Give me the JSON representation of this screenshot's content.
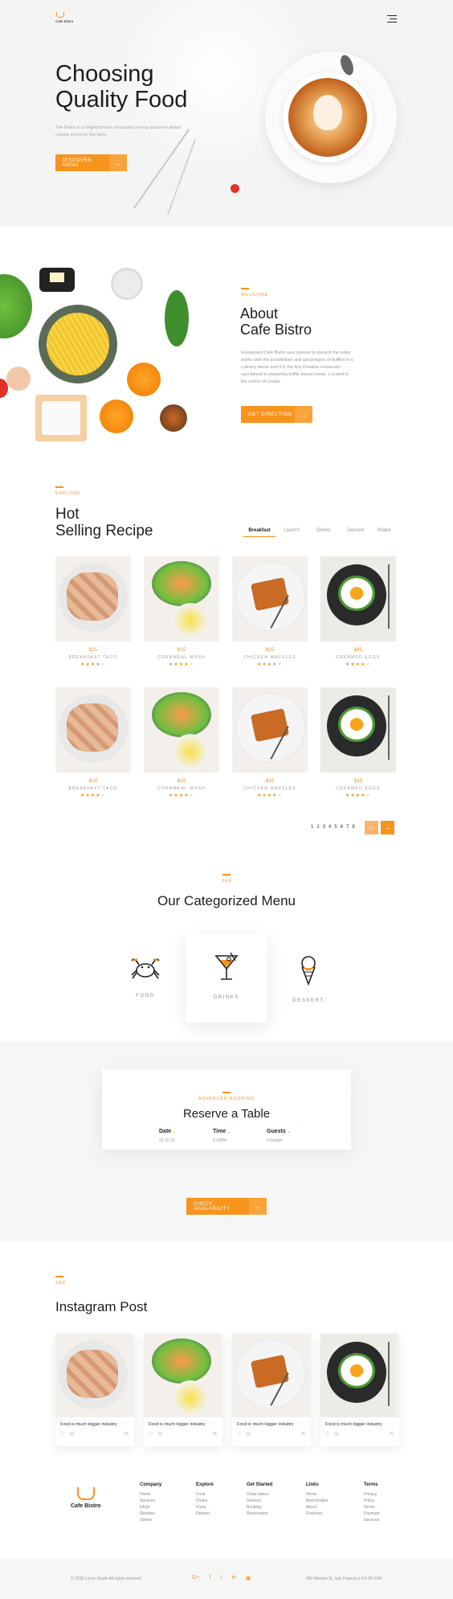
{
  "brand": {
    "name": "Cafe Bistro",
    "accent": "#f7941d"
  },
  "hero": {
    "title_line1": "Choosing",
    "title_line2": "Quality Food",
    "text": "The Bistro is a neighborhood restaurant serving seasonal global cuisine driven by the faire.",
    "button": "DISCOVER MENU",
    "arrow": "→"
  },
  "about": {
    "kicker": "WELCOME",
    "title_line1": "About",
    "title_line2": "Cafe Bistro",
    "text_lines": [
      "Restaurant Cafe Bistro was opened to present the wider",
      "public with the possibilities and advantages of truffles in a",
      "culinary sense and it is the first Croatian restaurant",
      "specialized in preparing truffle based meals. Located in",
      "the center of Livada"
    ],
    "button": "GET DIRECTION",
    "arrow": "→"
  },
  "recipes": {
    "kicker": "EXPLORE",
    "title_line1": "Hot",
    "title_line2": "Selling Recipe",
    "tabs": [
      "Breakfast",
      "Launch",
      "Dinner",
      "Dessert",
      "Shake"
    ],
    "items": [
      {
        "price": "$15",
        "name": "BREAKFAST TACO",
        "rating": 4
      },
      {
        "price": "$15",
        "name": "CORNMEAL MUSH",
        "rating": 4
      },
      {
        "price": "$25",
        "name": "CHICKEN WAFFLES",
        "rating": 4
      },
      {
        "price": "$45",
        "name": "CREAMED EGGS",
        "rating": 4
      },
      {
        "price": "$15",
        "name": "BREAKFAST TACO",
        "rating": 4
      },
      {
        "price": "$15",
        "name": "CORNMEAL MUSH",
        "rating": 4
      },
      {
        "price": "$32",
        "name": "CHICKEN WAFFLES",
        "rating": 4
      },
      {
        "price": "$45",
        "name": "CREAMED EGGS",
        "rating": 4
      }
    ],
    "pages": [
      "1",
      "2",
      "3",
      "4",
      "5",
      "6",
      "7",
      "8"
    ],
    "prev": "←",
    "next": "→"
  },
  "categories": {
    "kicker": "SEE",
    "title": "Our Categorized Menu",
    "items": [
      {
        "label": "FOOD",
        "icon": "crab-icon"
      },
      {
        "label": "DRINKS",
        "icon": "cocktail-icon"
      },
      {
        "label": "DESSERT",
        "icon": "ice-cream-icon"
      }
    ]
  },
  "booking": {
    "kicker": "ADVANCED BOOKING",
    "title": "Reserve a Table",
    "fields": [
      {
        "label": "Date",
        "value": "29.10.18"
      },
      {
        "label": "Time",
        "value": "5:30PM"
      },
      {
        "label": "Guests",
        "value": "5 People"
      }
    ],
    "button": "CHECK AVAILABILITY",
    "arrow": "→"
  },
  "instagram": {
    "kicker": "SEE",
    "title": "Instagram Post",
    "posts": [
      {
        "caption": "Food is much bigger industry"
      },
      {
        "caption": "Food is much bigger industry"
      },
      {
        "caption": "Food is much bigger industry"
      },
      {
        "caption": "Food is much bigger industry"
      }
    ]
  },
  "footer": {
    "columns": [
      {
        "title": "Company",
        "links": [
          "Home",
          "Services",
          "FAQs",
          "Reviews",
          "Stories"
        ]
      },
      {
        "title": "Explore",
        "links": [
          "Food",
          "Drinks",
          "Pizza",
          "Dessert"
        ]
      },
      {
        "title": "Get Started",
        "links": [
          "Order status",
          "Delivery",
          "Booking",
          "Reservation"
        ]
      },
      {
        "title": "Links",
        "links": [
          "Home",
          "Best foodies",
          "About",
          "Featured"
        ]
      },
      {
        "title": "Terms",
        "links": [
          "Privacy",
          "Policy",
          "Terms",
          "Payment",
          "Services"
        ]
      }
    ],
    "copyright": "© 2018 Lucvo Studio All rights reserved",
    "address": "560 Mission St, San Francisco CA 94 USA",
    "social": [
      "G+",
      "f",
      "t",
      "in",
      "▣"
    ]
  }
}
